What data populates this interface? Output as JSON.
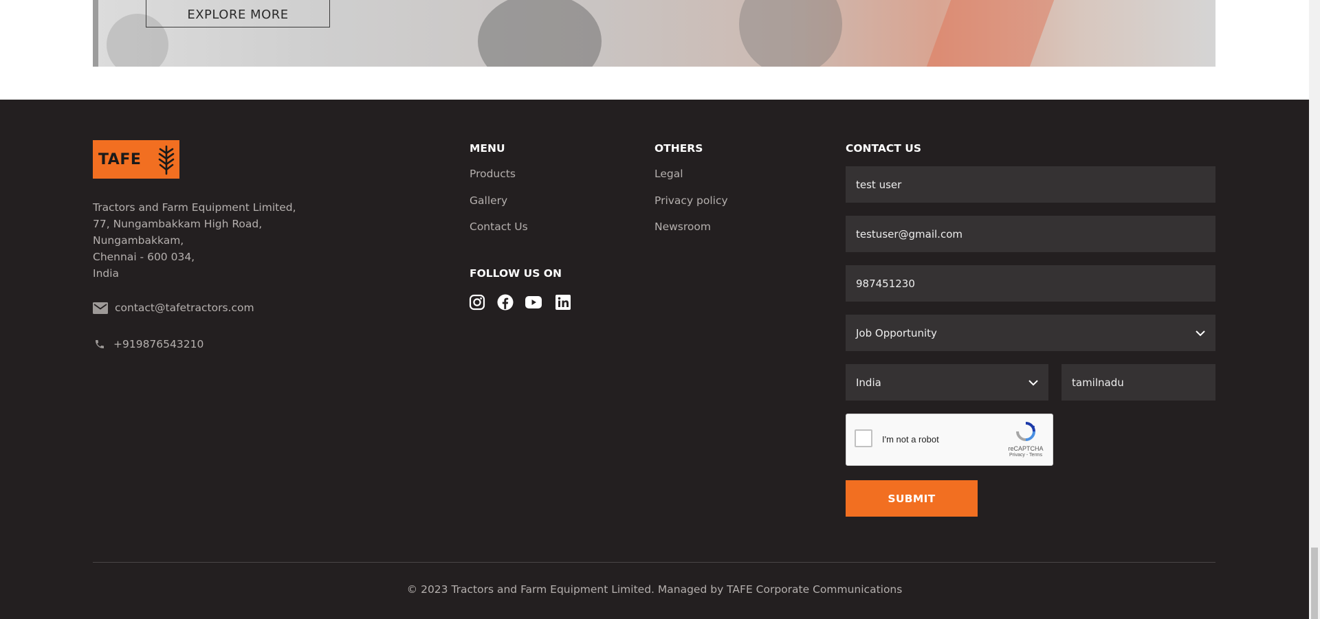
{
  "hero": {
    "explore_label": "EXPLORE MORE"
  },
  "logo": {
    "text": "TAFE"
  },
  "address": {
    "lines": [
      "Tractors and Farm Equipment Limited,",
      "77, Nungambakkam High Road,",
      "Nungambakkam,",
      "Chennai - 600 034,",
      "India"
    ],
    "email": "contact@tafetractors.com",
    "phone": "+919876543210"
  },
  "menu": {
    "heading": "MENU",
    "items": [
      "Products",
      "Gallery",
      "Contact Us"
    ]
  },
  "others": {
    "heading": "OTHERS",
    "items": [
      "Legal",
      "Privacy policy",
      "Newsroom"
    ]
  },
  "follow": {
    "heading": "FOLLOW US ON",
    "icons": [
      "instagram-icon",
      "facebook-icon",
      "youtube-icon",
      "linkedin-icon"
    ]
  },
  "contact": {
    "heading": "CONTACT US",
    "name_value": "test user",
    "email_value": "testuser@gmail.com",
    "phone_value": "987451230",
    "enquiry_value": "Job Opportunity",
    "country_value": "India",
    "state_value": "tamilnadu",
    "captcha_label": "I'm not a robot",
    "captcha_brand": "reCAPTCHA",
    "captcha_links": "Privacy - Terms",
    "submit_label": "SUBMIT"
  },
  "copyright": "© 2023 Tractors and Farm Equipment Limited. Managed by TAFE Corporate Communications",
  "colors": {
    "accent": "#f26f21",
    "footer_bg": "#231f20",
    "field_bg": "#353233",
    "muted_text": "#b5b0ae"
  }
}
